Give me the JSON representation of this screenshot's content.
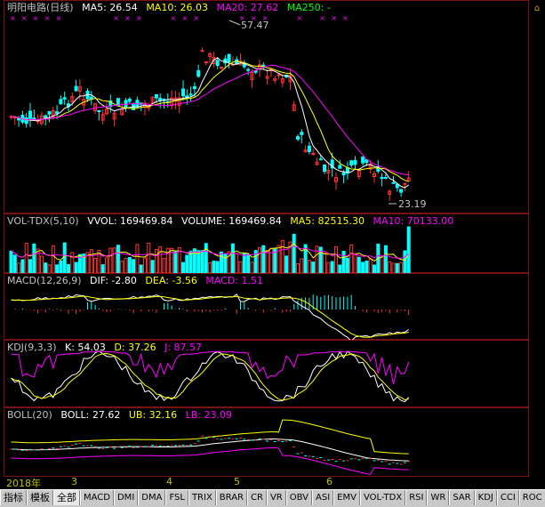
{
  "main": {
    "title": "明阳电路(日线)",
    "ma5": "MA5: 26.54",
    "ma10": "MA10: 26.03",
    "ma20": "MA20: 27.62",
    "ma250": "MA250: -",
    "high_label": "57.47",
    "low_label": "23.19",
    "colors": {
      "ma5": "#ffffff",
      "ma10": "#ffff00",
      "ma20": "#ff00ff",
      "ma250": "#00ff00"
    }
  },
  "vol": {
    "title": "VOL-TDX(5,10)",
    "vvol": "VVOL: 169469.84",
    "volume": "VOLUME: 169469.84",
    "ma5": "MA5: 82515.30",
    "ma10": "MA10: 70133.00"
  },
  "macd": {
    "title": "MACD(12,26,9)",
    "dif": "DIF: -2.80",
    "dea": "DEA: -3.56",
    "macd": "MACD: 1.51"
  },
  "kdj": {
    "title": "KDJ(9,3,3)",
    "k": "K: 54.03",
    "d": "D: 37.26",
    "j": "J: 87.57"
  },
  "boll": {
    "title": "BOLL(20)",
    "boll": "BOLL: 27.62",
    "ub": "UB: 32.16",
    "lb": "LB: 23.09"
  },
  "timeaxis": {
    "year": "2018年",
    "m3": "3",
    "m4": "4",
    "m5": "5",
    "m6": "6"
  },
  "rail": {
    "btn1": "⌂"
  },
  "tabs": [
    "指标",
    "模板",
    "全部",
    "MACD",
    "DMI",
    "DMA",
    "FSL",
    "TRIX",
    "BRAR",
    "CR",
    "VR",
    "OBV",
    "ASI",
    "EMV",
    "VOL-TDX",
    "RSI",
    "WR",
    "SAR",
    "KDJ",
    "CCI",
    "ROC"
  ]
}
